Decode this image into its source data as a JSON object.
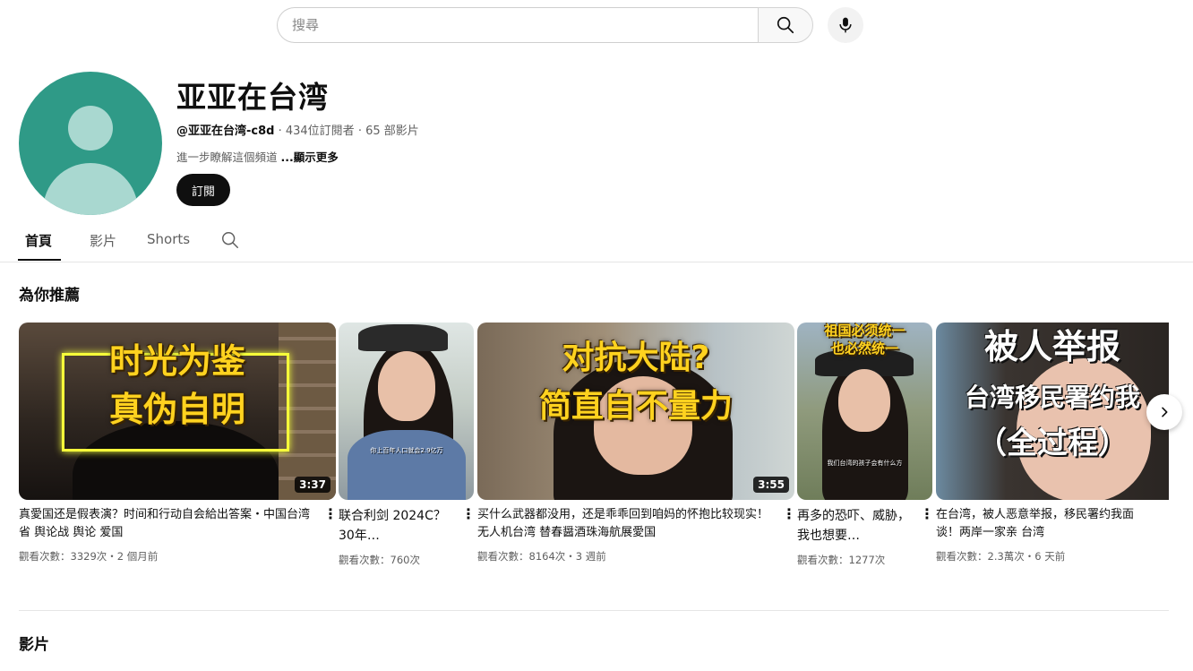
{
  "search": {
    "placeholder": "搜尋"
  },
  "channel": {
    "name": "亚亚在台湾",
    "handle": "@亚亚在台湾-c8d",
    "subscribers": "434位訂閱者",
    "video_count": "65 部影片",
    "about": "進一步瞭解這個頻道",
    "about_more": "...顯示更多",
    "subscribe_label": "訂閱"
  },
  "tabs": [
    {
      "label": "首頁"
    },
    {
      "label": "影片"
    },
    {
      "label": "Shorts"
    }
  ],
  "sections": {
    "recommended": "為你推薦",
    "videos": "影片"
  },
  "videos": [
    {
      "title": "真愛国还是假表演？时间和行动自会給出答案・中国台湾省 舆论战 舆论 爱国",
      "stats": "觀看次數：3329次・2 個月前",
      "duration": "3:37",
      "overlay": [
        "时光为鉴",
        "真伪自明"
      ]
    },
    {
      "title": "联合利剑 2024C？30年…",
      "stats": "觀看次數：760次",
      "overlay_caption": "你上百年人口就会2.9亿万"
    },
    {
      "title": "买什么武器都没用，还是乖乖回到咱妈的怀抱比较现实！无人机台湾 替春醤酒珠海航展愛国",
      "stats": "觀看次數：8164次・3 週前",
      "duration": "3:55",
      "overlay": [
        "对抗大陆?",
        "简直自不量力"
      ]
    },
    {
      "title": "再多的恐吓、威胁，我也想要…",
      "stats": "觀看次數：1277次",
      "overlay": [
        "祖国必须统一",
        "也必然统一"
      ],
      "overlay_caption": "我们台湾的孩子会有什么方"
    },
    {
      "title": "在台湾，被人恶意举报，移民署约我面谈！两岸一家亲 台湾",
      "stats": "觀看次數：2.3萬次・6 天前",
      "overlay": [
        "被人举报",
        "台湾移民署约我",
        "（全过程）"
      ]
    }
  ],
  "icons": {
    "search": "search-icon",
    "mic": "mic-icon",
    "tab_search": "search-icon",
    "more": "more-vert-icon",
    "next": "chevron-right-icon"
  },
  "colors": {
    "avatar_bg": "#2f9a87",
    "avatar_fg": "#a9d8d0",
    "subscribe_bg": "#0f0f0f",
    "overlay_yellow": "#ffd21f"
  }
}
